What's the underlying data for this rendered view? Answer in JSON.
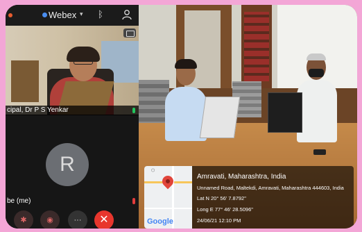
{
  "phone": {
    "app_name": "Webex",
    "remote_participant": {
      "name_label": "cipal, Dr P S Yenkar"
    },
    "self_participant": {
      "avatar_letter": "R",
      "name_label": "be (me)"
    },
    "controls": {
      "more_label": "···",
      "end_label": "✕"
    }
  },
  "geo_overlay": {
    "city": "Amravati, Maharashtra, India",
    "address": "Unnamed Road, Maltekdi, Amravati, Maharashtra 444603, India",
    "latitude": "Lat N 20° 56' 7.8792\"",
    "longitude": "Long E 77° 46' 28.5096\"",
    "datetime": "24/06/21 12:10 PM",
    "map_logo": "Google"
  },
  "colors": {
    "border": "#f3a6d6",
    "end_call": "#e8362d",
    "mic_on": "#22c55e",
    "mic_off": "#e23c3c",
    "webex_dot": "#4a8ef0"
  }
}
